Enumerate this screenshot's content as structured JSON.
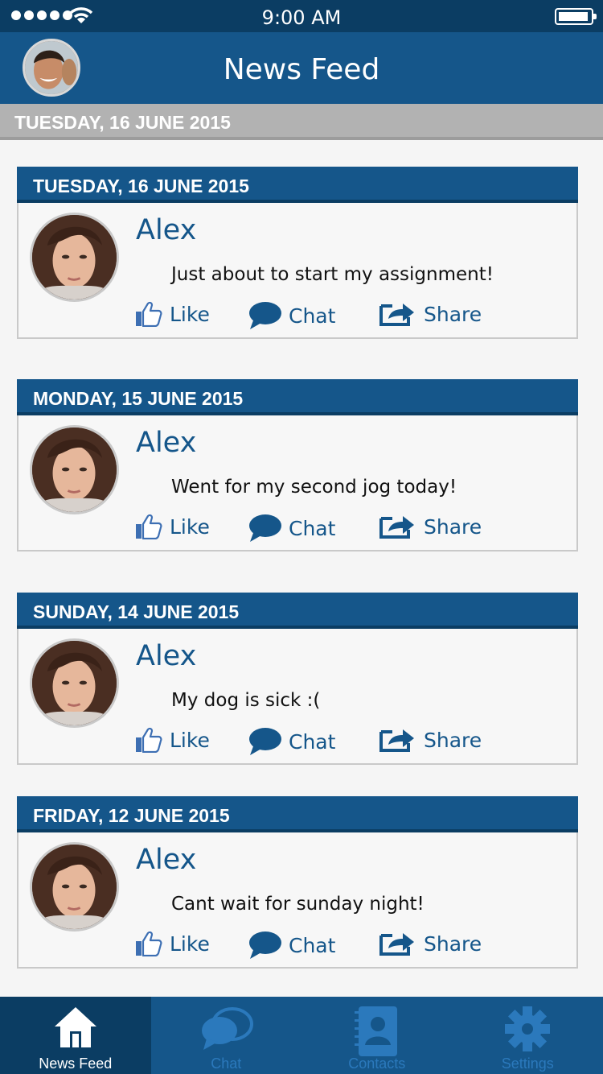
{
  "status_bar": {
    "time": "9:00 AM"
  },
  "nav": {
    "title": "News Feed"
  },
  "sticky_date": "TUESDAY, 16 JUNE 2015",
  "actions": {
    "like": "Like",
    "chat": "Chat",
    "share": "Share"
  },
  "posts": [
    {
      "date": "TUESDAY, 16 JUNE 2015",
      "name": "Alex",
      "text": "Just about to start my assignment!"
    },
    {
      "date": "MONDAY, 15 JUNE 2015",
      "name": "Alex",
      "text": "Went for my second jog today!"
    },
    {
      "date": "SUNDAY, 14 JUNE 2015",
      "name": "Alex",
      "text": "My dog is sick :("
    },
    {
      "date": "FRIDAY, 12 JUNE 2015",
      "name": "Alex",
      "text": "Cant wait for sunday night!"
    }
  ],
  "tabs": [
    {
      "label": "News Feed",
      "icon": "home-icon",
      "active": true
    },
    {
      "label": "Chat",
      "icon": "chat-bubbles-icon",
      "active": false
    },
    {
      "label": "Contacts",
      "icon": "contacts-book-icon",
      "active": false
    },
    {
      "label": "Settings",
      "icon": "gear-icon",
      "active": false
    }
  ],
  "colors": {
    "primary": "#15568a",
    "dark": "#0b3d63",
    "inactive_tab": "#2b79bc"
  }
}
